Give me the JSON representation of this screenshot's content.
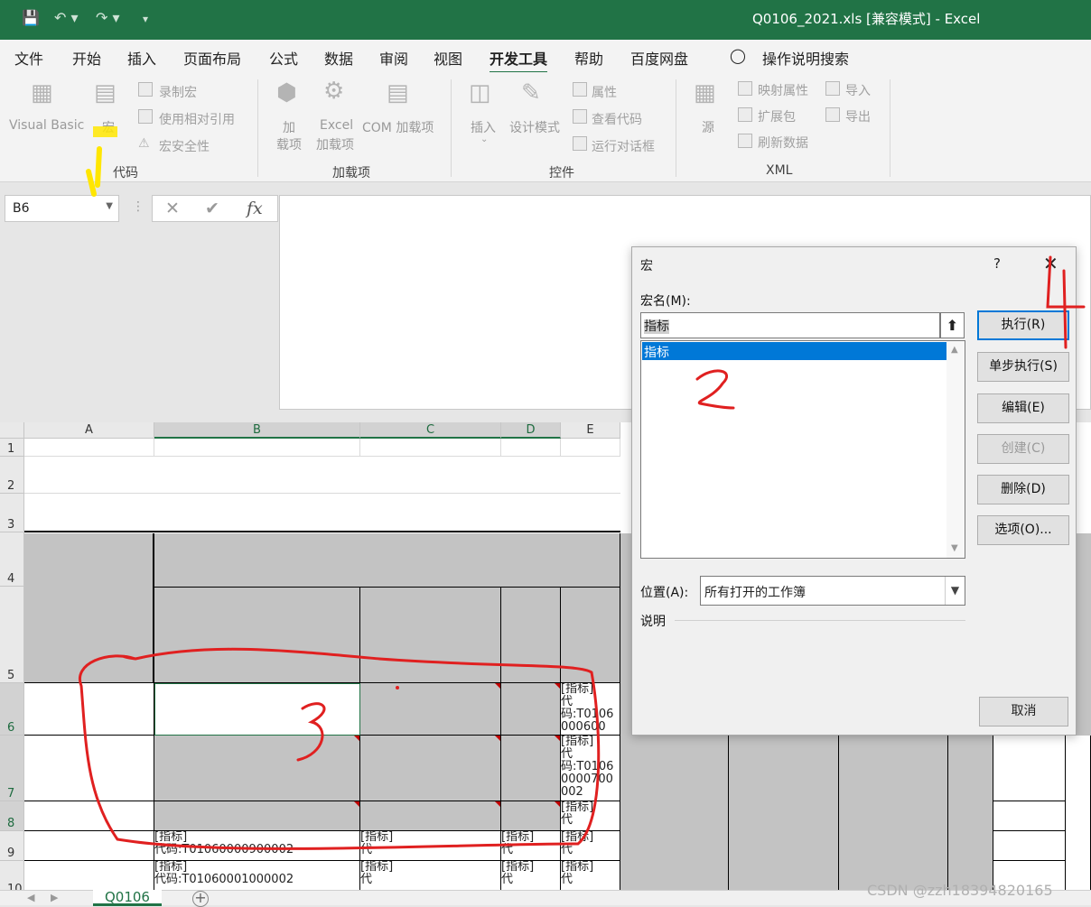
{
  "window": {
    "title": "Q0106_2021.xls  [兼容模式]  -  Excel"
  },
  "quick_access": {
    "save_icon": "save-icon",
    "undo_icon": "undo-icon",
    "redo_icon": "redo-icon",
    "more": "▾"
  },
  "tabs": [
    "文件",
    "开始",
    "插入",
    "页面布局",
    "公式",
    "数据",
    "审阅",
    "视图",
    "开发工具",
    "帮助",
    "百度网盘"
  ],
  "tell_me": "操作说明搜索",
  "ribbon": {
    "code": {
      "visual_basic": "Visual Basic",
      "macro": "宏",
      "record": "录制宏",
      "relative": "使用相对引用",
      "security": "宏安全性",
      "group": "代码"
    },
    "addins": {
      "addins_line1": "加",
      "addins_line2": "载项",
      "excel_line1": "Excel",
      "excel_line2": "加载项",
      "com": "COM 加载项",
      "group": "加载项"
    },
    "controls": {
      "insert": "插入",
      "design": "设计模式",
      "properties": "属性",
      "view_code": "查看代码",
      "run_dialog": "运行对话框",
      "group": "控件"
    },
    "xml": {
      "source": "源",
      "map_props": "映射属性",
      "expansion": "扩展包",
      "refresh": "刷新数据",
      "import": "导入",
      "export": "导出",
      "group": "XML"
    }
  },
  "formula_bar": {
    "name_box": "B6",
    "cancel": "✕",
    "enter": "✔",
    "fx": "fx"
  },
  "columns": [
    "A",
    "B",
    "C",
    "D",
    "E"
  ],
  "rows": [
    "1",
    "2",
    "3",
    "4",
    "5",
    "6",
    "7",
    "8",
    "9",
    "10"
  ],
  "cells": {
    "e6": "[指标]\n代\n码:T0106\n000600",
    "e7": "[指标]\n代\n码:T0106\n0000700\n002",
    "e8": "[指标]\n代",
    "b9": "[指标]\n代码:T01060000900002",
    "c9": "[指标]\n代",
    "d9": "[指标]\n代",
    "e9": "[指标]\n代",
    "b10": "[指标]\n代码:T01060001000002",
    "c10": "[指标]\n代",
    "d10": "[指标]\n代",
    "e10": "[指标]\n代"
  },
  "sheet": {
    "name": "Q0106",
    "add": "+"
  },
  "watermark": "CSDN @zzh18394820165",
  "dialog": {
    "title": "宏",
    "help": "?",
    "close": "✕",
    "name_label": "宏名(M):",
    "name_value": "指标",
    "list": [
      "指标"
    ],
    "buttons": {
      "run": "执行(R)",
      "step": "单步执行(S)",
      "edit": "编辑(E)",
      "create": "创建(C)",
      "delete": "删除(D)",
      "options": "选项(O)...",
      "cancel": "取消"
    },
    "location_label": "位置(A):",
    "location_value": "所有打开的工作簿",
    "description_label": "说明"
  },
  "annotations": {
    "step1": "1",
    "step2": "2",
    "step3": "3",
    "step4": "4"
  },
  "colors": {
    "excel_green": "#217346",
    "selection_blue": "#0078d7",
    "annotation_red": "#e02020",
    "highlight_yellow": "#ffe600"
  }
}
